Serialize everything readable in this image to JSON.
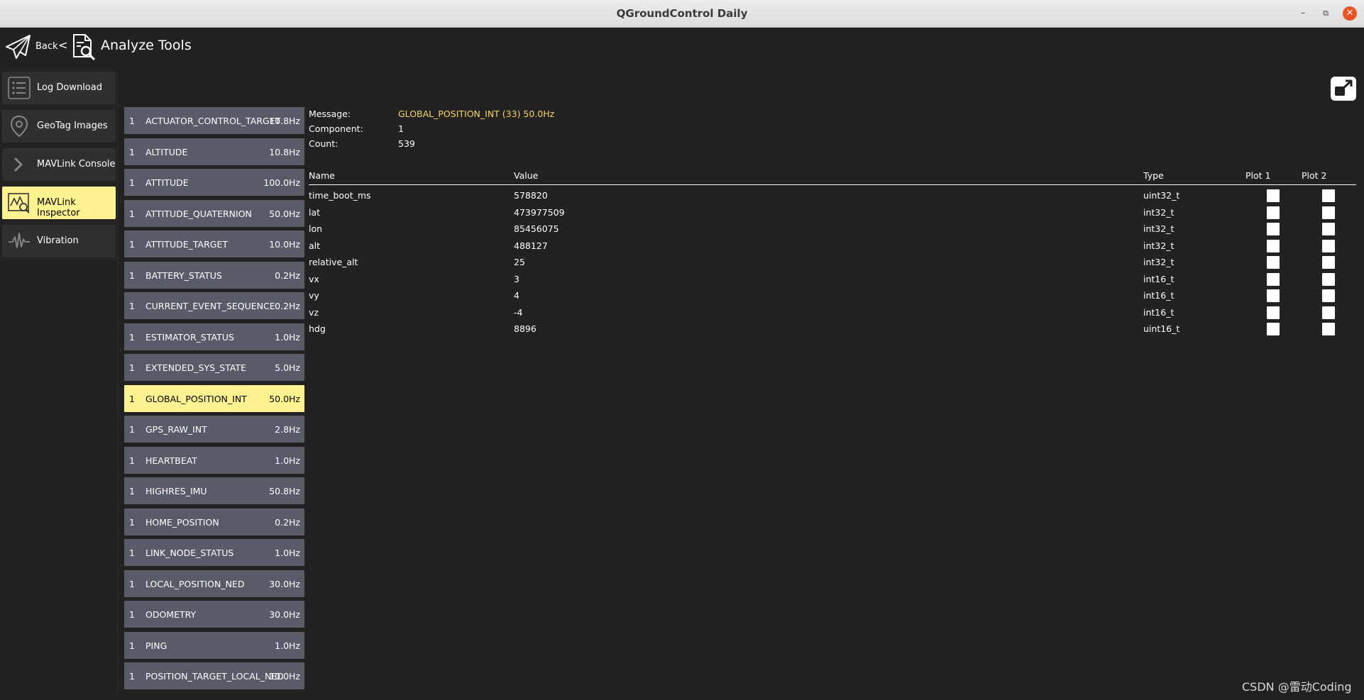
{
  "window": {
    "title": "QGroundControl Daily"
  },
  "header": {
    "back_label": "Back",
    "separator": "<",
    "title": "Analyze Tools"
  },
  "nav": [
    {
      "label": "Log Download",
      "icon": "list-icon"
    },
    {
      "label": "GeoTag Images",
      "icon": "map-pin-icon"
    },
    {
      "label": "MAVLink Console",
      "icon": "chevron-right-icon"
    },
    {
      "label": "MAVLink Inspector",
      "icon": "inspector-icon",
      "active": true
    },
    {
      "label": "Vibration",
      "icon": "waveform-icon"
    }
  ],
  "messages": [
    {
      "comp": "1",
      "name": "ACTUATOR_CONTROL_TARGET",
      "rate": "10.8Hz"
    },
    {
      "comp": "1",
      "name": "ALTITUDE",
      "rate": "10.8Hz"
    },
    {
      "comp": "1",
      "name": "ATTITUDE",
      "rate": "100.0Hz"
    },
    {
      "comp": "1",
      "name": "ATTITUDE_QUATERNION",
      "rate": "50.0Hz"
    },
    {
      "comp": "1",
      "name": "ATTITUDE_TARGET",
      "rate": "10.0Hz"
    },
    {
      "comp": "1",
      "name": "BATTERY_STATUS",
      "rate": "0.2Hz"
    },
    {
      "comp": "1",
      "name": "CURRENT_EVENT_SEQUENCE",
      "rate": "0.2Hz"
    },
    {
      "comp": "1",
      "name": "ESTIMATOR_STATUS",
      "rate": "1.0Hz"
    },
    {
      "comp": "1",
      "name": "EXTENDED_SYS_STATE",
      "rate": "5.0Hz"
    },
    {
      "comp": "1",
      "name": "GLOBAL_POSITION_INT",
      "rate": "50.0Hz",
      "active": true
    },
    {
      "comp": "1",
      "name": "GPS_RAW_INT",
      "rate": "2.8Hz"
    },
    {
      "comp": "1",
      "name": "HEARTBEAT",
      "rate": "1.0Hz"
    },
    {
      "comp": "1",
      "name": "HIGHRES_IMU",
      "rate": "50.8Hz"
    },
    {
      "comp": "1",
      "name": "HOME_POSITION",
      "rate": "0.2Hz"
    },
    {
      "comp": "1",
      "name": "LINK_NODE_STATUS",
      "rate": "1.0Hz"
    },
    {
      "comp": "1",
      "name": "LOCAL_POSITION_NED",
      "rate": "30.0Hz"
    },
    {
      "comp": "1",
      "name": "ODOMETRY",
      "rate": "30.0Hz"
    },
    {
      "comp": "1",
      "name": "PING",
      "rate": "1.0Hz"
    },
    {
      "comp": "1",
      "name": "POSITION_TARGET_LOCAL_NED",
      "rate": "10.0Hz"
    }
  ],
  "details": {
    "message_label": "Message:",
    "message_value": "GLOBAL_POSITION_INT (33) 50.0Hz",
    "component_label": "Component:",
    "component_value": "1",
    "count_label": "Count:",
    "count_value": "539"
  },
  "table": {
    "headers": {
      "name": "Name",
      "value": "Value",
      "type": "Type",
      "plot1": "Plot 1",
      "plot2": "Plot 2"
    },
    "rows": [
      {
        "name": "time_boot_ms",
        "value": "578820",
        "type": "uint32_t"
      },
      {
        "name": "lat",
        "value": "473977509",
        "type": "int32_t"
      },
      {
        "name": "lon",
        "value": "85456075",
        "type": "int32_t"
      },
      {
        "name": "alt",
        "value": "488127",
        "type": "int32_t"
      },
      {
        "name": "relative_alt",
        "value": "25",
        "type": "int32_t"
      },
      {
        "name": "vx",
        "value": "3",
        "type": "int16_t"
      },
      {
        "name": "vy",
        "value": "4",
        "type": "int16_t"
      },
      {
        "name": "vz",
        "value": "-4",
        "type": "int16_t"
      },
      {
        "name": "hdg",
        "value": "8896",
        "type": "uint16_t"
      }
    ]
  },
  "watermark": "CSDN @雷动Coding",
  "colors": {
    "highlight": "#fff291",
    "message_value": "#f4d35e",
    "list_bg": "#595b68",
    "background": "#222222"
  }
}
